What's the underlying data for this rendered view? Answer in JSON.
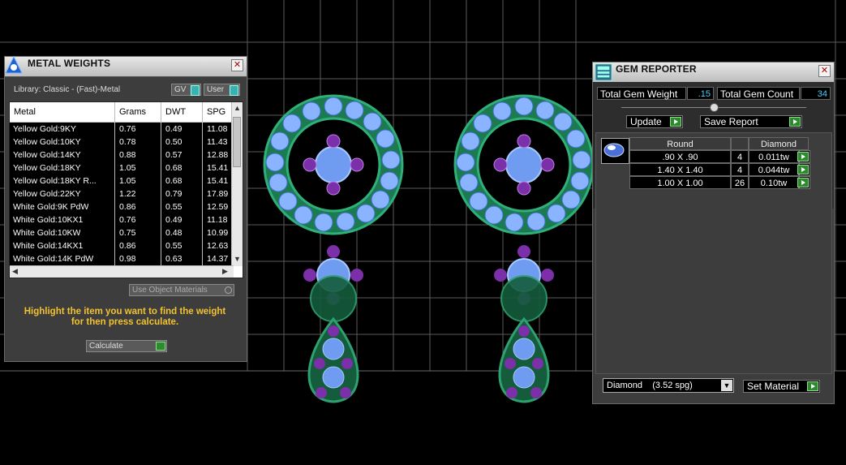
{
  "metal_weights": {
    "title": "METAL WEIGHTS",
    "library_label": "Library: Classic - (Fast)-Metal",
    "gv_label": "GV",
    "user_label": "User",
    "columns": [
      "Metal",
      "Grams",
      "DWT",
      "SPG"
    ],
    "rows": [
      [
        "Yellow Gold:9KY",
        "0.76",
        "0.49",
        "11.08"
      ],
      [
        "Yellow Gold:10KY",
        "0.78",
        "0.50",
        "11.43"
      ],
      [
        "Yellow Gold:14KY",
        "0.88",
        "0.57",
        "12.88"
      ],
      [
        "Yellow Gold:18KY",
        "1.05",
        "0.68",
        "15.41"
      ],
      [
        "Yellow Gold:18KY R...",
        "1.05",
        "0.68",
        "15.41"
      ],
      [
        "Yellow Gold:22KY",
        "1.22",
        "0.79",
        "17.89"
      ],
      [
        "White Gold:9K PdW",
        "0.86",
        "0.55",
        "12.59"
      ],
      [
        "White Gold:10KX1",
        "0.76",
        "0.49",
        "11.18"
      ],
      [
        "White Gold:10KW",
        "0.75",
        "0.48",
        "10.99"
      ],
      [
        "White Gold:14KX1",
        "0.86",
        "0.55",
        "12.63"
      ],
      [
        "White Gold:14K PdW",
        "0.98",
        "0.63",
        "14.37"
      ]
    ],
    "use_object_materials": "Use Object Materials",
    "hint_line1": "Highlight the item you want to find the weight",
    "hint_line2": "for then press calculate.",
    "calculate_label": "Calculate"
  },
  "gem_reporter": {
    "title": "GEM REPORTER",
    "total_weight_label": "Total Gem Weight",
    "total_weight_value": ".15",
    "total_count_label": "Total Gem Count",
    "total_count_value": "34",
    "update_label": "Update",
    "save_report_label": "Save Report",
    "table_headers": [
      "Round",
      "",
      "Diamond"
    ],
    "rows": [
      [
        ".90 X .90",
        "4",
        "0.011tw"
      ],
      [
        "1.40 X 1.40",
        "4",
        "0.044tw"
      ],
      [
        "1.00 X 1.00",
        "26",
        "0.10tw"
      ]
    ],
    "material_select": "Diamond    (3.52 spg)",
    "set_material_label": "Set Material"
  }
}
